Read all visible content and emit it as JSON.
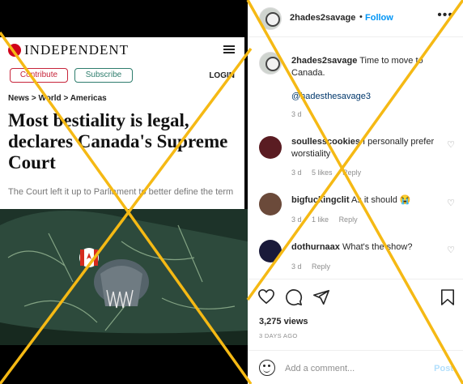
{
  "article": {
    "brand": "INDEPENDENT",
    "contribute_label": "Contribute",
    "subscribe_label": "Subscribe",
    "login_label": "LOGIN",
    "breadcrumb": "News > World > Americas",
    "headline": "Most bestiality is legal, declares Canada's Supreme Court",
    "subhead": "The Court left it up to Parliament to better define the term"
  },
  "post": {
    "username": "2hades2savage",
    "separator": "•",
    "follow_label": "Follow",
    "more_icon": "more-icon",
    "caption_user": "2hades2savage",
    "caption_text": "Time to move to Canada.",
    "caption_mention": "@hadesthesavage3",
    "caption_time": "3 d"
  },
  "comments": [
    {
      "user": "soullesscookies",
      "text": "I personally prefer worstiality",
      "time": "3 d",
      "likes": "5 likes",
      "reply": "Reply",
      "avatar_color": "#5a1c22"
    },
    {
      "user": "bigfuckingclit",
      "text": "As it should 😭",
      "time": "3 d",
      "likes": "1 like",
      "reply": "Reply",
      "avatar_color": "#6b4a3a"
    },
    {
      "user": "dothurnaax",
      "text": "What's the show?",
      "time": "3 d",
      "likes": "",
      "reply": "Reply",
      "avatar_color": "#1a1a3a"
    }
  ],
  "stats": {
    "views": "3,275 views",
    "ago": "3 DAYS AGO"
  },
  "add_comment": {
    "placeholder": "Add a comment...",
    "post_label": "Post"
  },
  "colors": {
    "follow": "#0095f6",
    "cross": "#f5b914",
    "contribute": "#c7243a",
    "subscribe": "#2e7d6d"
  }
}
